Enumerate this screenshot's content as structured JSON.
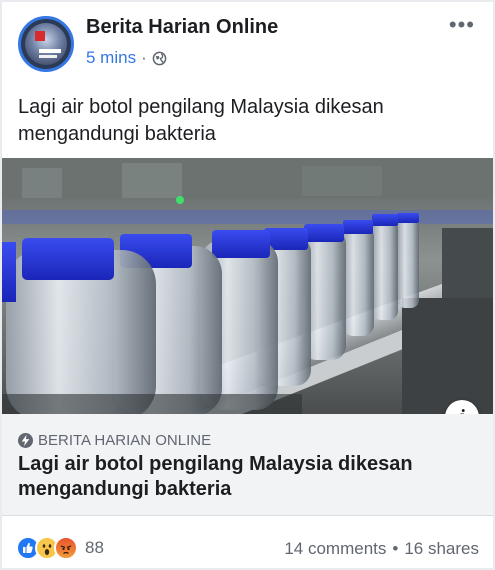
{
  "post": {
    "page_name": "Berita Harian Online",
    "time": "5 mins",
    "separator": "·",
    "privacy_icon": "globe-icon",
    "more_label": "•••",
    "text": "Lagi air botol pengilang Malaysia dikesan mengandungi bakteria"
  },
  "link": {
    "domain": "BERITA HARIAN ONLINE",
    "title": "Lagi air botol pengilang Malaysia dikesan mengandungi bakteria",
    "info_label": "i"
  },
  "engagement": {
    "reactions": [
      "like-icon",
      "wow-icon",
      "angry-icon"
    ],
    "reaction_count": "88",
    "comments": "14 comments",
    "separator": "•",
    "shares": "16 shares"
  },
  "colors": {
    "accent": "#3578e5",
    "bottle_cap": "#2436d6",
    "muted": "#606770"
  }
}
